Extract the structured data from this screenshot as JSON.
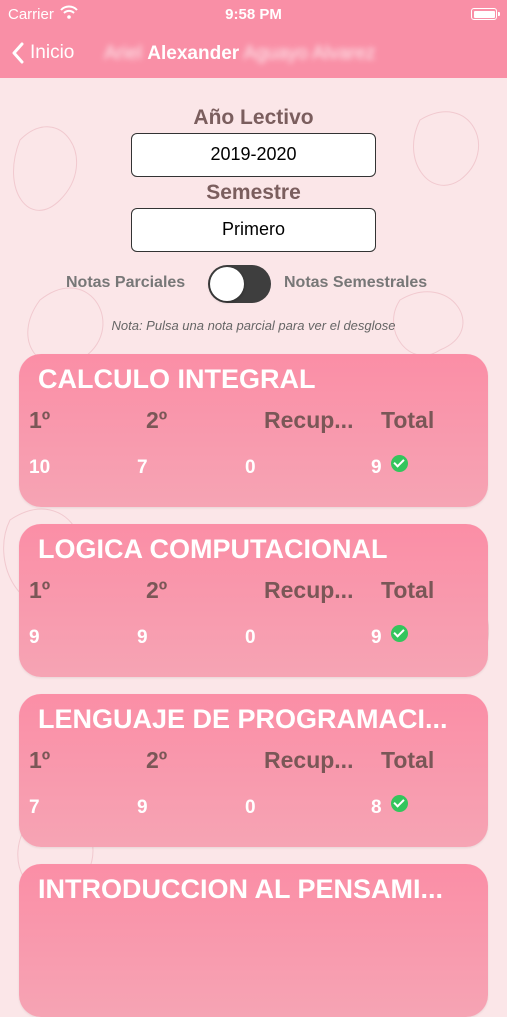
{
  "status_bar": {
    "carrier": "Carrier",
    "time": "9:58 PM"
  },
  "nav": {
    "back_label": "Inicio",
    "title_blur_first": "Ariel",
    "title_main": "Alexander",
    "title_blur_last": "Aguayo Alvarez"
  },
  "form": {
    "year_label": "Año Lectivo",
    "year_value": "2019-2020",
    "semester_label": "Semestre",
    "semester_value": "Primero",
    "toggle_left": "Notas Parciales",
    "toggle_right": "Notas Semestrales",
    "note": "Nota: Pulsa una nota parcial para ver el desglose"
  },
  "columns": {
    "first": "1º",
    "second": "2º",
    "recup": "Recup...",
    "total": "Total"
  },
  "courses": [
    {
      "name": "CALCULO INTEGRAL",
      "first": "10",
      "second": "7",
      "recup": "0",
      "total": "9"
    },
    {
      "name": "LOGICA COMPUTACIONAL",
      "first": "9",
      "second": "9",
      "recup": "0",
      "total": "9"
    },
    {
      "name": "LENGUAJE DE PROGRAMACI...",
      "first": "7",
      "second": "9",
      "recup": "0",
      "total": "8"
    },
    {
      "name": "INTRODUCCION AL PENSAMI...",
      "first": "",
      "second": "",
      "recup": "",
      "total": ""
    }
  ],
  "colors": {
    "accent": "#f98fa6",
    "card": "#fb8ea6",
    "check": "#33c55c"
  },
  "icons": {
    "wifi": "wifi-icon",
    "battery": "battery-icon",
    "back": "chevron-left-icon",
    "check": "checkmark-circle-icon"
  }
}
